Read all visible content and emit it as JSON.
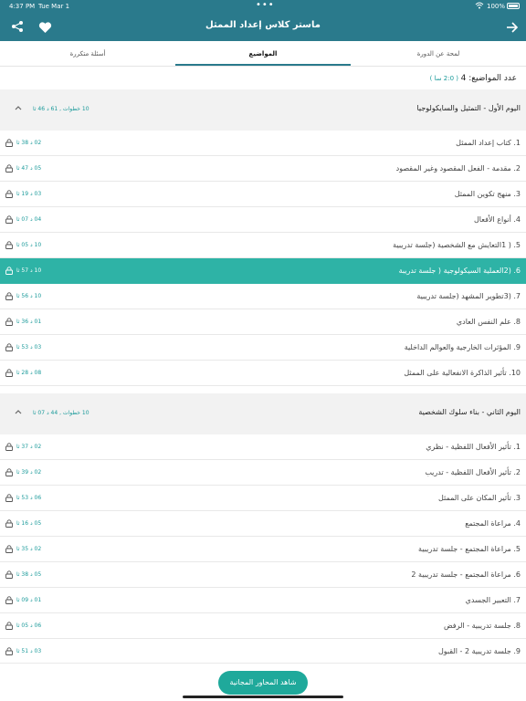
{
  "status_bar": {
    "time": "4:37 PM",
    "date": "Tue Mar 1",
    "battery_text": "100%"
  },
  "header": {
    "title": "ماستر كلاس إعداد الممثل",
    "share_icon": "share-icon",
    "heart_icon": "heart-icon",
    "back_icon": "arrow-right-icon",
    "bg_color": "#2a7a8c"
  },
  "tabs": [
    {
      "label": "أسئلة متكررة"
    },
    {
      "label": "المواضيع",
      "selected": true
    },
    {
      "label": "لمحة عن الدورة"
    }
  ],
  "topics_count": {
    "label": "عدد المواضيع: 4",
    "duration": "( 2:0 سا )"
  },
  "sections": [
    {
      "title": "اليوم الأول - التمثيل والسايكولوجيا",
      "meta": "10 خطوات , 61 د 46 ثا",
      "lessons": [
        {
          "title": "1. كتاب إعداد الممثل",
          "duration": "02 د 38 ثا"
        },
        {
          "title": "2. مقدمة - الفعل المقصود وغير المقصود",
          "duration": "05 د 47 ثا"
        },
        {
          "title": "3. منهج تكوين الممثل",
          "duration": "03 د 19 ثا"
        },
        {
          "title": "4. أنواع الأفعال",
          "duration": "04 د 07 ثا"
        },
        {
          "title": "5. ( 1التعايش مع الشخصية (جلسة تدريبية",
          "duration": "10 د 05 ثا"
        },
        {
          "title": "6. (2العملية السيكولوجية ( جلسة تدريبة",
          "duration": "10 د 57 ثا",
          "active": true
        },
        {
          "title": "7. (3تطوير المشهد (جلسة تدريبية",
          "duration": "10 د 56 ثا"
        },
        {
          "title": "8. علم النفس العادي",
          "duration": "01 د 36 ثا"
        },
        {
          "title": "9. المؤثرات الخارجية والعوالم الداخلية",
          "duration": "03 د 53 ثا"
        },
        {
          "title": "10. تأثير الذاكرة الانفعالية على الممثل",
          "duration": "08 د 28 ثا"
        }
      ]
    },
    {
      "title": "اليوم الثاني - بناء سلوك الشخصية",
      "meta": "10 خطوات , 44 د 07 ثا",
      "lessons": [
        {
          "title": "1. تأثير الأفعال اللفظية - نظري",
          "duration": "02 د 37 ثا"
        },
        {
          "title": "2. تأثير الأفعال اللفظية - تدريب",
          "duration": "02 د 39 ثا"
        },
        {
          "title": "3. تأثير المكان على الممثل",
          "duration": "06 د 53 ثا"
        },
        {
          "title": "4. مراعاة المجتمع",
          "duration": "05 د 16 ثا"
        },
        {
          "title": "5. مراعاة المجتمع - جلسة تدريبية",
          "duration": "02 د 35 ثا"
        },
        {
          "title": "6. مراعاة المجتمع - جلسة تدريبية 2",
          "duration": "05 د 38 ثا"
        },
        {
          "title": "7. التعبير الجسدي",
          "duration": "01 د 09 ثا"
        },
        {
          "title": "8. جلسة تدريبية - الرفض",
          "duration": "06 د 05 ثا"
        },
        {
          "title": "9. جلسة تدريبية 2 - القبول",
          "duration": "03 د 51 ثا"
        }
      ]
    }
  ],
  "cta": {
    "label": "شاهد المحاور المجانية",
    "color": "#1fa99b"
  },
  "accent_color": "#2eb3a6"
}
